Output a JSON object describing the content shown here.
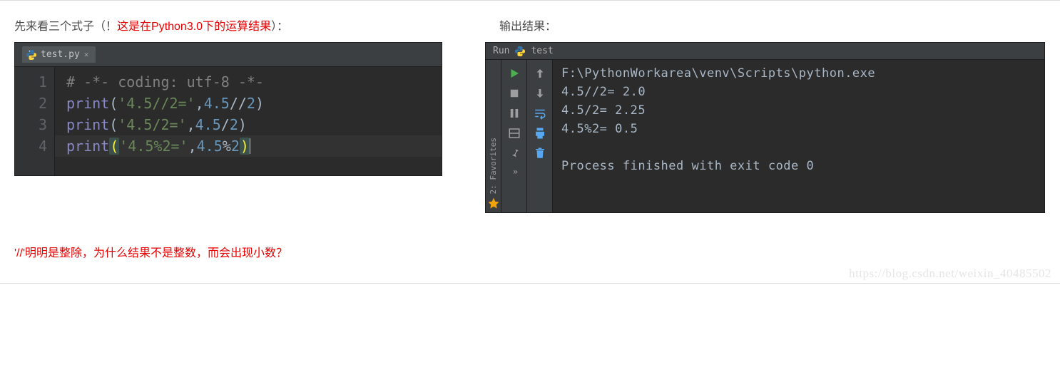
{
  "header": {
    "left_pre": "先来看三个式子（！",
    "left_red": "这是在Python3.0下的运算结果",
    "left_post": "）：",
    "right": "输出结果："
  },
  "editor": {
    "tab_filename": "test.py",
    "gutter": [
      "1",
      "2",
      "3",
      "4"
    ],
    "line1": "# -*- coding: utf-8 -*-",
    "line2a": "print",
    "line2b": "(",
    "line2c": "'4.5//2='",
    "line2d": ",",
    "line2e": "4.5",
    "line2f": "//",
    "line2g": "2",
    "line2h": ")",
    "line3a": "print",
    "line3b": "(",
    "line3c": "'4.5/2='",
    "line3d": ",",
    "line3e": "4.5",
    "line3f": "/",
    "line3g": "2",
    "line3h": ")",
    "line4a": "print",
    "line4b": "(",
    "line4c": "'4.5%2='",
    "line4d": ",",
    "line4e": "4.5",
    "line4f": "%",
    "line4g": "2",
    "line4h": ")"
  },
  "run": {
    "header_label": "Run",
    "config_name": "test",
    "favorites_label": "2: Favorites",
    "console_text": "F:\\PythonWorkarea\\venv\\Scripts\\python.exe\n4.5//2= 2.0\n4.5/2= 2.25\n4.5%2= 0.5\n\nProcess finished with exit code 0"
  },
  "question": "'//'明明是整除，为什么结果不是整数，而会出现小数？",
  "watermark": "https://blog.csdn.net/weixin_40485502"
}
